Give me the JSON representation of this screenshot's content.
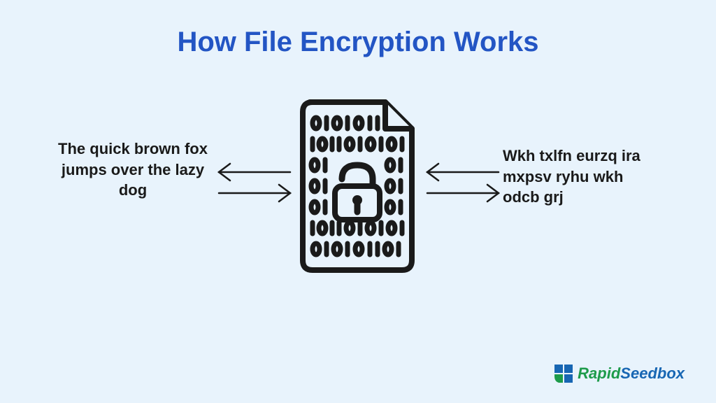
{
  "title": "How File Encryption Works",
  "plaintext": "The quick brown fox jumps over the lazy dog",
  "ciphertext": "Wkh txlfn eurzq ira mxpsv ryhu wkh odcb grj",
  "logo": {
    "rapid": "Rapid",
    "seedbox": "Seedbox"
  }
}
